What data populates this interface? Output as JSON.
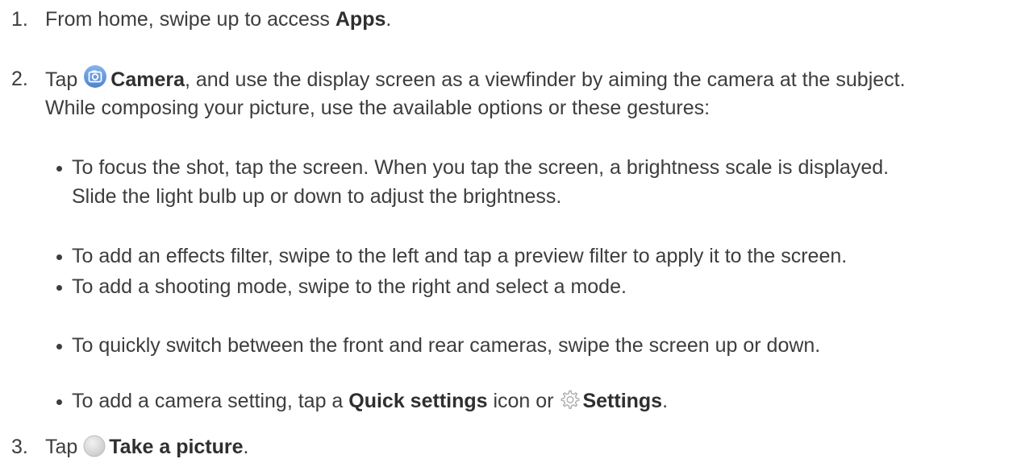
{
  "steps": [
    {
      "number": "1.",
      "text_before": "From home, swipe up to access ",
      "bold": "Apps",
      "text_after": "."
    },
    {
      "number": "2.",
      "lead": "Tap ",
      "icon": "camera-icon",
      "bold": "Camera",
      "line1_after": ", and use the display screen as a viewfinder by aiming the camera at the subject.",
      "line2": "While composing your picture, use the available options or these gestures:"
    },
    {
      "number": "3.",
      "lead": "Tap ",
      "icon": "shutter-button-icon",
      "bold": "Take a picture",
      "text_after": "."
    }
  ],
  "bullets": [
    {
      "line1": "To focus the shot, tap the screen. When you tap the screen, a brightness scale is displayed.",
      "line2": "Slide the light bulb up or down to adjust the brightness."
    },
    {
      "line1": "To add an effects filter, swipe to the left and tap a preview filter to apply it to the screen."
    },
    {
      "line1": "To add a shooting mode, swipe to the right and select a mode."
    },
    {
      "line1": "To quickly switch between the front and rear cameras, swipe the screen up or down."
    },
    {
      "text_before": "To add a camera setting, tap a ",
      "bold1": "Quick settings",
      "middle": " icon or ",
      "icon": "gear-icon",
      "bold2": "Settings",
      "text_after": "."
    }
  ],
  "colors": {
    "text": "#3d3d3d",
    "camera_icon": "#5c8fd6",
    "gear_icon": "#b0b0b0",
    "shutter_icon": "#d4d4d4"
  }
}
